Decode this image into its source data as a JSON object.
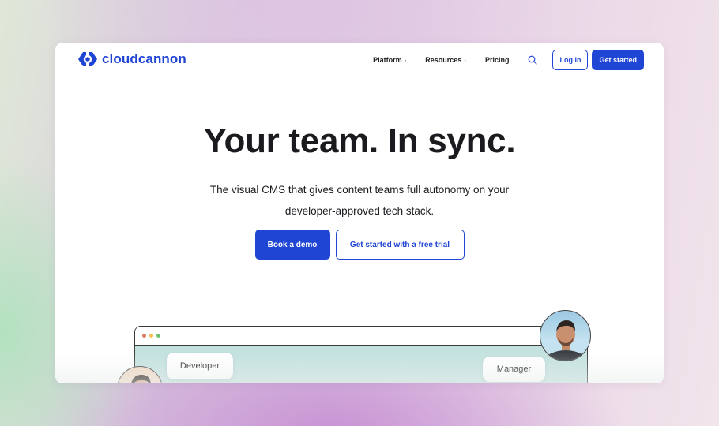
{
  "brand": {
    "name": "cloudcannon",
    "logo_icon": "cloudcannon-logo-icon",
    "accent_color": "#1f45d4"
  },
  "nav": {
    "items": [
      {
        "label": "Platform",
        "has_chevron": true,
        "chevron": "›"
      },
      {
        "label": "Resources",
        "has_chevron": true,
        "chevron": "›"
      },
      {
        "label": "Pricing",
        "has_chevron": false
      }
    ],
    "search_icon": "search-icon",
    "login_label": "Log in",
    "get_started_label": "Get started"
  },
  "hero": {
    "title": "Your team. In sync.",
    "subtitle_line1": "The visual CMS that gives content teams full autonomy on your",
    "subtitle_line2": "developer-approved tech stack.",
    "primary_cta": "Book a demo",
    "secondary_cta": "Get started with a free trial"
  },
  "illustration": {
    "window_dots": [
      "#e07a5f",
      "#f2c14e",
      "#6cc070"
    ],
    "developer_label": "Developer",
    "manager_label": "Manager"
  }
}
